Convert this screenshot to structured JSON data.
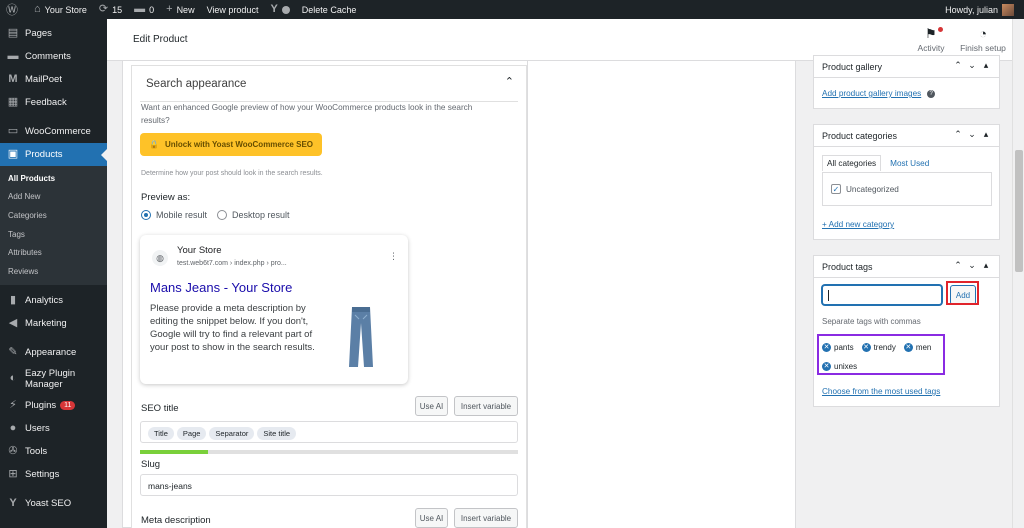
{
  "admin_bar": {
    "site_name": "Your Store",
    "updates_count": "15",
    "comments_count": "0",
    "new_label": "New",
    "view_product": "View product",
    "delete_cache": "Delete Cache",
    "howdy": "Howdy, julian"
  },
  "sidebar": {
    "items": [
      {
        "icon": "pages-icon",
        "label": "Pages"
      },
      {
        "icon": "comments-icon",
        "label": "Comments"
      },
      {
        "icon": "mailpoet-icon",
        "label": "MailPoet"
      },
      {
        "icon": "feedback-icon",
        "label": "Feedback"
      },
      {
        "icon": "woocommerce-icon",
        "label": "WooCommerce"
      },
      {
        "icon": "products-icon",
        "label": "Products"
      },
      {
        "icon": "analytics-icon",
        "label": "Analytics"
      },
      {
        "icon": "marketing-icon",
        "label": "Marketing"
      },
      {
        "icon": "appearance-icon",
        "label": "Appearance"
      },
      {
        "icon": "eazy-plugin-icon",
        "label": "Eazy Plugin Manager"
      },
      {
        "icon": "plugins-icon",
        "label": "Plugins",
        "badge": "11"
      },
      {
        "icon": "users-icon",
        "label": "Users"
      },
      {
        "icon": "tools-icon",
        "label": "Tools"
      },
      {
        "icon": "settings-icon",
        "label": "Settings"
      },
      {
        "icon": "yoast-icon",
        "label": "Yoast SEO"
      }
    ],
    "products_submenu": [
      "All Products",
      "Add New",
      "Categories",
      "Tags",
      "Attributes",
      "Reviews"
    ]
  },
  "header": {
    "title": "Edit Product",
    "activity_label": "Activity",
    "finish_setup_label": "Finish setup"
  },
  "yoast": {
    "section_title": "Search appearance",
    "upsell_text": "Want an enhanced Google preview of how your WooCommerce products look in the search results?",
    "upsell_button": "Unlock with Yoast WooCommerce SEO",
    "hint": "Determine how your post should look in the search results.",
    "preview_as": "Preview as:",
    "mobile_result": "Mobile result",
    "desktop_result": "Desktop result",
    "preview": {
      "site": "Your Store",
      "url": "test.web6t7.com › index.php › pro...",
      "title": "Mans Jeans - Your Store",
      "description": "Please provide a meta description by editing the snippet below. If you don't, Google will try to find a relevant part of your post to show in the search results."
    },
    "seo_title_label": "SEO title",
    "use_ai": "Use AI",
    "insert_variable": "Insert variable",
    "title_pills": [
      "Title",
      "Page",
      "Separator",
      "Site title"
    ],
    "title_progress": 0.18,
    "slug_label": "Slug",
    "slug_value": "mans-jeans",
    "meta_description_label": "Meta description"
  },
  "gallery": {
    "title": "Product gallery",
    "link": "Add product gallery images"
  },
  "categories": {
    "title": "Product categories",
    "tab_all": "All categories",
    "tab_most_used": "Most Used",
    "items": [
      {
        "label": "Uncategorized",
        "checked": true
      }
    ],
    "add_link": "+ Add new category"
  },
  "tags": {
    "title": "Product tags",
    "input_value": "",
    "add_button": "Add",
    "hint": "Separate tags with commas",
    "list": [
      "pants",
      "trendy",
      "men",
      "unixes"
    ],
    "most_used_link": "Choose from the most used tags"
  },
  "colors": {
    "accent": "#2271b1",
    "adminbar": "#1d2327",
    "highlight_red": "#e0242b",
    "highlight_purple": "#8a2be2",
    "yoast_yellow": "#fec228"
  }
}
